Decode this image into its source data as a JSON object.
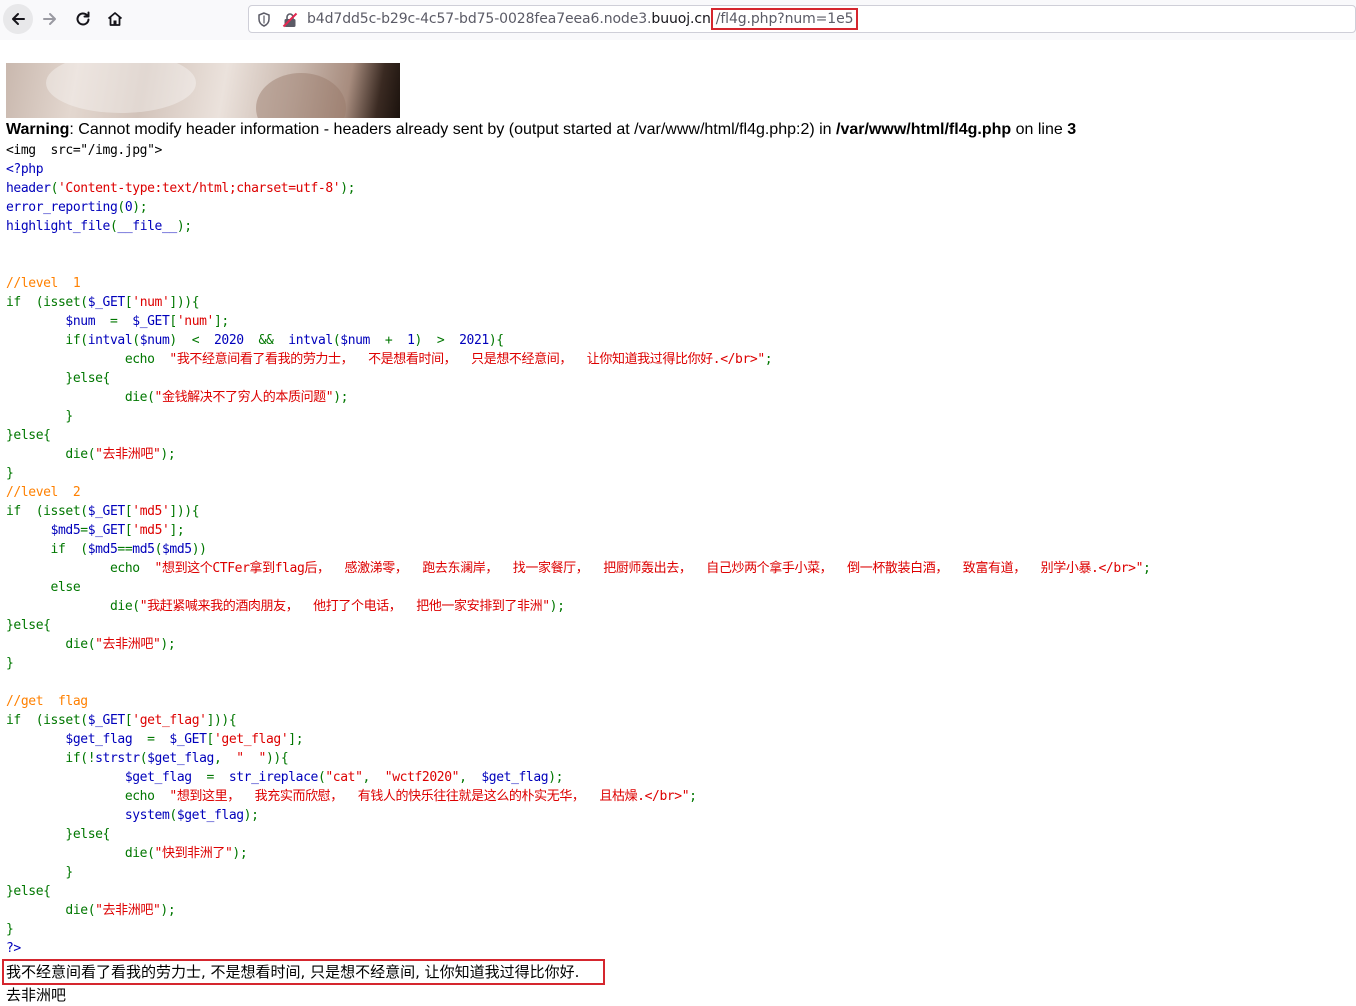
{
  "browser": {
    "url_prefix": "b4d7dd5c-b29c-4c57-bd75-0028fea7eea6.node3.",
    "url_domain": "buuoj.cn",
    "url_path": "/fl4g.php?num=1e5"
  },
  "warning": {
    "label": "Warning",
    "text_before": ": Cannot modify header information - headers already sent by (output started at /var/www/html/fl4g.php:2) in ",
    "file": "/var/www/html/fl4g.php",
    "text_middle": " on line ",
    "line_no": "3"
  },
  "code_lines": [
    [
      [
        "html",
        "<img  src=\"/img.jpg\">"
      ]
    ],
    [
      [
        "def",
        "<?php"
      ]
    ],
    [
      [
        "def",
        "header"
      ],
      [
        "key",
        "("
      ],
      [
        "str",
        "'Content-type:text/html;charset=utf-8'"
      ],
      [
        "key",
        ");"
      ]
    ],
    [
      [
        "def",
        "error_reporting"
      ],
      [
        "key",
        "("
      ],
      [
        "def",
        "0"
      ],
      [
        "key",
        ");"
      ]
    ],
    [
      [
        "def",
        "highlight_file"
      ],
      [
        "key",
        "("
      ],
      [
        "def",
        "__file__"
      ],
      [
        "key",
        ");"
      ]
    ],
    [],
    [],
    [
      [
        "cmt",
        "//level  1"
      ]
    ],
    [
      [
        "key",
        "if  (isset("
      ],
      [
        "def",
        "$_GET"
      ],
      [
        "key",
        "["
      ],
      [
        "str",
        "'num'"
      ],
      [
        "key",
        "])){"
      ]
    ],
    [
      [
        "key",
        "        "
      ],
      [
        "def",
        "$num  "
      ],
      [
        "key",
        "=  "
      ],
      [
        "def",
        "$_GET"
      ],
      [
        "key",
        "["
      ],
      [
        "str",
        "'num'"
      ],
      [
        "key",
        "];"
      ]
    ],
    [
      [
        "key",
        "        if("
      ],
      [
        "def",
        "intval"
      ],
      [
        "key",
        "("
      ],
      [
        "def",
        "$num"
      ],
      [
        "key",
        ")  <  "
      ],
      [
        "def",
        "2020  "
      ],
      [
        "key",
        "&&  "
      ],
      [
        "def",
        "intval"
      ],
      [
        "key",
        "("
      ],
      [
        "def",
        "$num  "
      ],
      [
        "key",
        "+  "
      ],
      [
        "def",
        "1"
      ],
      [
        "key",
        ")  >  "
      ],
      [
        "def",
        "2021"
      ],
      [
        "key",
        "){"
      ]
    ],
    [
      [
        "key",
        "                echo  "
      ],
      [
        "str",
        "\"我不经意间看了看我的劳力士，  不是想看时间，  只是想不经意间，  让你知道我过得比你好.</br>\""
      ],
      [
        "key",
        ";"
      ]
    ],
    [
      [
        "key",
        "        }else{"
      ]
    ],
    [
      [
        "key",
        "                die("
      ],
      [
        "str",
        "\"金钱解决不了穷人的本质问题\""
      ],
      [
        "key",
        ");"
      ]
    ],
    [
      [
        "key",
        "        }"
      ]
    ],
    [
      [
        "key",
        "}else{"
      ]
    ],
    [
      [
        "key",
        "        die("
      ],
      [
        "str",
        "\"去非洲吧\""
      ],
      [
        "key",
        ");"
      ]
    ],
    [
      [
        "key",
        "}"
      ]
    ],
    [
      [
        "cmt",
        "//level  2"
      ]
    ],
    [
      [
        "key",
        "if  (isset("
      ],
      [
        "def",
        "$_GET"
      ],
      [
        "key",
        "["
      ],
      [
        "str",
        "'md5'"
      ],
      [
        "key",
        "])){"
      ]
    ],
    [
      [
        "key",
        "      "
      ],
      [
        "def",
        "$md5"
      ],
      [
        "key",
        "="
      ],
      [
        "def",
        "$_GET"
      ],
      [
        "key",
        "["
      ],
      [
        "str",
        "'md5'"
      ],
      [
        "key",
        "];"
      ]
    ],
    [
      [
        "key",
        "      if  ("
      ],
      [
        "def",
        "$md5"
      ],
      [
        "key",
        "=="
      ],
      [
        "def",
        "md5"
      ],
      [
        "key",
        "("
      ],
      [
        "def",
        "$md5"
      ],
      [
        "key",
        "))"
      ]
    ],
    [
      [
        "key",
        "              echo  "
      ],
      [
        "str",
        "\"想到这个CTFer拿到flag后，  感激涕零，  跑去东澜岸，  找一家餐厅，  把厨师轰出去，  自己炒两个拿手小菜，  倒一杯散装白酒，  致富有道，  别学小暴.</br>\""
      ],
      [
        "key",
        ";"
      ]
    ],
    [
      [
        "key",
        "      else"
      ]
    ],
    [
      [
        "key",
        "              die("
      ],
      [
        "str",
        "\"我赶紧喊来我的酒肉朋友，  他打了个电话，  把他一家安排到了非洲\""
      ],
      [
        "key",
        ");"
      ]
    ],
    [
      [
        "key",
        "}else{"
      ]
    ],
    [
      [
        "key",
        "        die("
      ],
      [
        "str",
        "\"去非洲吧\""
      ],
      [
        "key",
        ");"
      ]
    ],
    [
      [
        "key",
        "}"
      ]
    ],
    [],
    [
      [
        "cmt",
        "//get  flag"
      ]
    ],
    [
      [
        "key",
        "if  (isset("
      ],
      [
        "def",
        "$_GET"
      ],
      [
        "key",
        "["
      ],
      [
        "str",
        "'get_flag'"
      ],
      [
        "key",
        "])){"
      ]
    ],
    [
      [
        "key",
        "        "
      ],
      [
        "def",
        "$get_flag  "
      ],
      [
        "key",
        "=  "
      ],
      [
        "def",
        "$_GET"
      ],
      [
        "key",
        "["
      ],
      [
        "str",
        "'get_flag'"
      ],
      [
        "key",
        "];"
      ]
    ],
    [
      [
        "key",
        "        if(!"
      ],
      [
        "def",
        "strstr"
      ],
      [
        "key",
        "("
      ],
      [
        "def",
        "$get_flag"
      ],
      [
        "key",
        ",  "
      ],
      [
        "str",
        "\"  \""
      ],
      [
        "key",
        "))"
      ],
      [
        "key",
        "{"
      ]
    ],
    [
      [
        "key",
        "                "
      ],
      [
        "def",
        "$get_flag  "
      ],
      [
        "key",
        "=  "
      ],
      [
        "def",
        "str_ireplace"
      ],
      [
        "key",
        "("
      ],
      [
        "str",
        "\"cat\""
      ],
      [
        "key",
        ",  "
      ],
      [
        "str",
        "\"wctf2020\""
      ],
      [
        "key",
        ",  "
      ],
      [
        "def",
        "$get_flag"
      ],
      [
        "key",
        ");"
      ]
    ],
    [
      [
        "key",
        "                echo  "
      ],
      [
        "str",
        "\"想到这里，  我充实而欣慰，  有钱人的快乐往往就是这么的朴实无华，  且枯燥.</br>\""
      ],
      [
        "key",
        ";"
      ]
    ],
    [
      [
        "key",
        "                "
      ],
      [
        "def",
        "system"
      ],
      [
        "key",
        "("
      ],
      [
        "def",
        "$get_flag"
      ],
      [
        "key",
        ");"
      ]
    ],
    [
      [
        "key",
        "        }else{"
      ]
    ],
    [
      [
        "key",
        "                die("
      ],
      [
        "str",
        "\"快到非洲了\""
      ],
      [
        "key",
        ");"
      ]
    ],
    [
      [
        "key",
        "        }"
      ]
    ],
    [
      [
        "key",
        "}else{"
      ]
    ],
    [
      [
        "key",
        "        die("
      ],
      [
        "str",
        "\"去非洲吧\""
      ],
      [
        "key",
        ");"
      ]
    ],
    [
      [
        "key",
        "}"
      ]
    ],
    [
      [
        "def",
        "?>"
      ]
    ]
  ],
  "output": {
    "line1": "我不经意间看了看我的劳力士, 不是想看时间, 只是想不经意间, 让你知道我过得比你好.",
    "line2": "去非洲吧"
  }
}
